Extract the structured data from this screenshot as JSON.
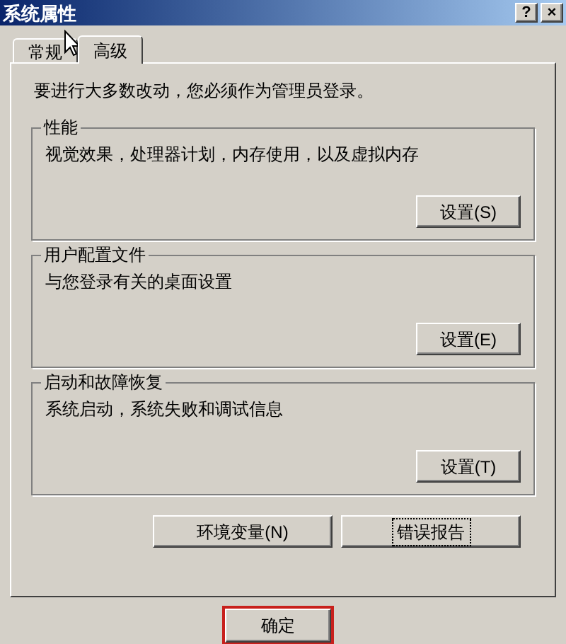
{
  "window": {
    "title": "系统属性",
    "title_buttons": [
      "?",
      "×"
    ]
  },
  "tabs": [
    {
      "label": "常规",
      "selected": false
    },
    {
      "label": "高级",
      "selected": true
    }
  ],
  "notice": "要进行大多数改动，您必须作为管理员登录。",
  "groups": [
    {
      "title": "性能",
      "description": "视觉效果，处理器计划，内存使用，以及虚拟内存",
      "button": "设置(S)"
    },
    {
      "title": "用户配置文件",
      "description": "与您登录有关的桌面设置",
      "button": "设置(E)"
    },
    {
      "title": "启动和故障恢复",
      "description": "系统启动，系统失败和调试信息",
      "button": "设置(T)"
    }
  ],
  "panel_buttons": [
    {
      "label": "环境变量(N)",
      "focused": false
    },
    {
      "label": "错误报告",
      "focused": true
    }
  ],
  "dialog_buttons": [
    {
      "label": "确定",
      "highlighted": true
    }
  ]
}
